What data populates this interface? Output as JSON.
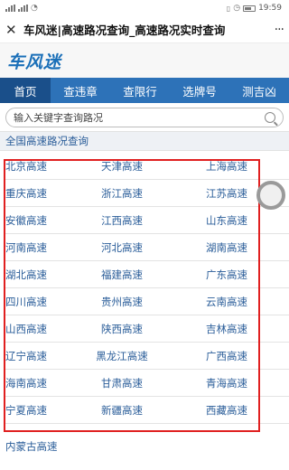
{
  "statusbar": {
    "left": "℃¹ ℃¹",
    "time": "19:59"
  },
  "titlebar": {
    "close_glyph": "✕",
    "title": "车风迷|高速路况查询_高速路况实时查询",
    "more_glyph": "···"
  },
  "brand": {
    "name": "车风迷"
  },
  "nav": {
    "items": [
      {
        "label": "首页"
      },
      {
        "label": "查违章"
      },
      {
        "label": "查限行"
      },
      {
        "label": "选牌号"
      },
      {
        "label": "测吉凶"
      }
    ]
  },
  "search": {
    "placeholder": "输入关键字查询路况"
  },
  "section": {
    "title": "全国高速路况查询"
  },
  "highways": [
    [
      "北京高速",
      "天津高速",
      "上海高速"
    ],
    [
      "重庆高速",
      "浙江高速",
      "江苏高速"
    ],
    [
      "安徽高速",
      "江西高速",
      "山东高速"
    ],
    [
      "河南高速",
      "河北高速",
      "湖南高速"
    ],
    [
      "湖北高速",
      "福建高速",
      "广东高速"
    ],
    [
      "四川高速",
      "贵州高速",
      "云南高速"
    ],
    [
      "山西高速",
      "陕西高速",
      "吉林高速"
    ],
    [
      "辽宁高速",
      "黑龙江高速",
      "广西高速"
    ],
    [
      "海南高速",
      "甘肃高速",
      "青海高速"
    ],
    [
      "宁夏高速",
      "新疆高速",
      "西藏高速"
    ]
  ],
  "footer": {
    "link": "内蒙古高速"
  },
  "colors": {
    "nav_bg": "#2d72b8",
    "nav_active": "#1a4f8a",
    "link": "#2a5d99",
    "brand": "#1a6fb8",
    "highlight": "#e02020"
  }
}
